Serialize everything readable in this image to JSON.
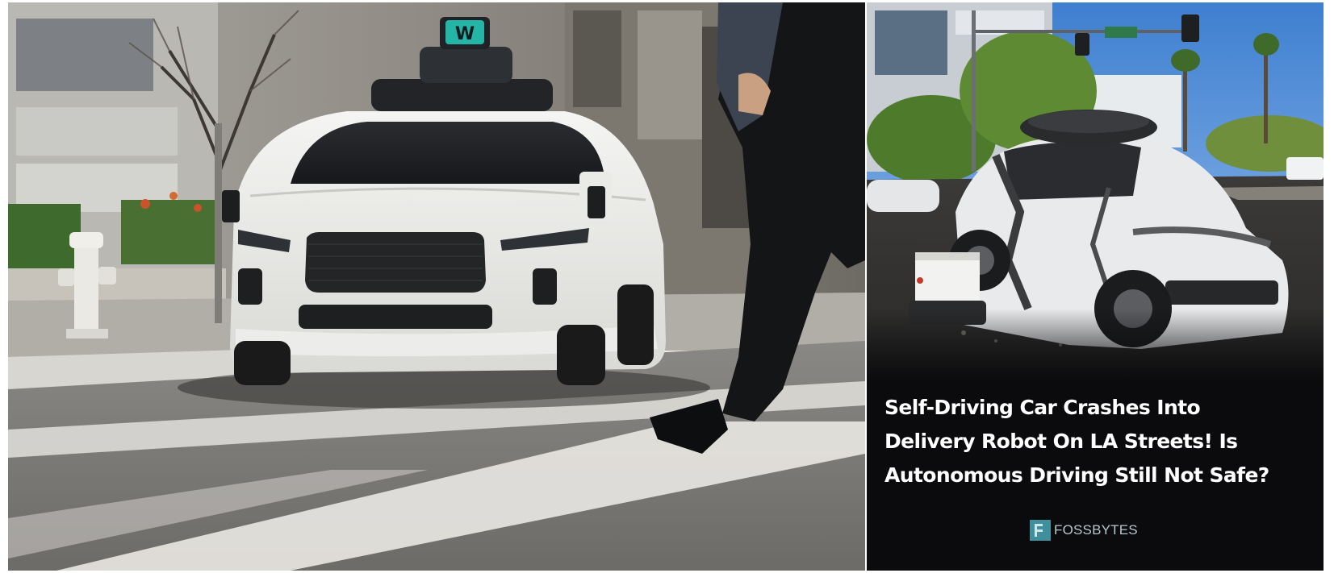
{
  "left_photo": {
    "roof_badge_letter": "W"
  },
  "news_card": {
    "headline_lines": [
      "Self-Driving Car Crashes Into",
      "Delivery Robot On LA Streets! Is",
      "Autonomous Driving Still Not Safe?"
    ],
    "brand": "FOSSBYTES",
    "brand_icon": "fossbytes-logo-icon",
    "colors": {
      "background": "#0b0b0d",
      "headline": "#ffffff",
      "brand_accent": "#3f8f9c"
    }
  }
}
